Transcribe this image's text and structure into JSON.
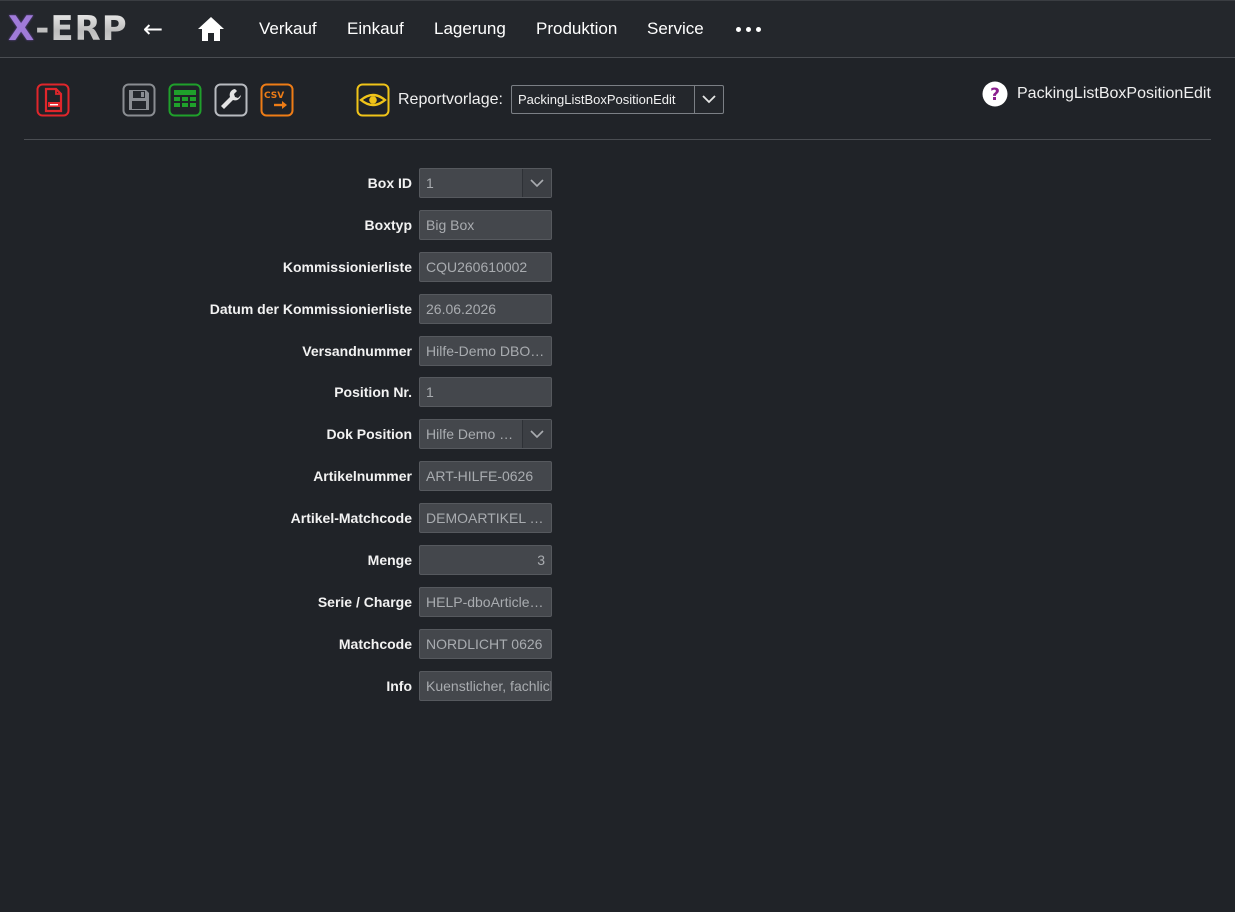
{
  "app": {
    "logo_x": "X",
    "logo_rest": "-ERP"
  },
  "nav": {
    "back": "←",
    "items": [
      "Verkauf",
      "Einkauf",
      "Lagerung",
      "Produktion",
      "Service"
    ]
  },
  "toolbar": {
    "report_label": "Reportvorlage:",
    "report_value": "PackingListBoxPositionEdit",
    "help_label": "PackingListBoxPositionEdit",
    "csv_text": "CSV"
  },
  "form": {
    "fields": [
      {
        "label": "Box ID",
        "value": "1",
        "type": "select"
      },
      {
        "label": "Boxtyp",
        "value": "Big Box",
        "type": "text"
      },
      {
        "label": "Kommissionierliste",
        "value": "CQU260610002",
        "type": "text"
      },
      {
        "label": "Datum der Kommissionierliste",
        "value": "26.06.2026",
        "type": "text"
      },
      {
        "label": "Versandnummer",
        "value": "Hilfe-Demo DBOShipment",
        "type": "text"
      },
      {
        "label": "Position Nr.",
        "value": "1",
        "type": "text"
      },
      {
        "label": "Dok Position",
        "value": "Hilfe Demo Position",
        "type": "select"
      },
      {
        "label": "Artikelnummer",
        "value": "ART-HILFE-0626",
        "type": "text"
      },
      {
        "label": "Artikel-Matchcode",
        "value": "DEMOARTIKEL HILFE",
        "type": "text"
      },
      {
        "label": "Menge",
        "value": "3",
        "type": "number"
      },
      {
        "label": "Serie / Charge",
        "value": "HELP-dboArticleSerial",
        "type": "text"
      },
      {
        "label": "Matchcode",
        "value": "NORDLICHT 0626",
        "type": "text"
      },
      {
        "label": "Info",
        "value": "Kuenstlicher, fachlicher Hilfetext",
        "type": "textclip"
      }
    ]
  },
  "colors": {
    "background": "#202328",
    "field_bg": "#44474c",
    "pdf_red": "#e0262b",
    "excel_green": "#1fa12b",
    "csv_orange": "#ee7c16",
    "eye_yellow": "#f0c419",
    "help_purple": "#8b1f8f"
  }
}
